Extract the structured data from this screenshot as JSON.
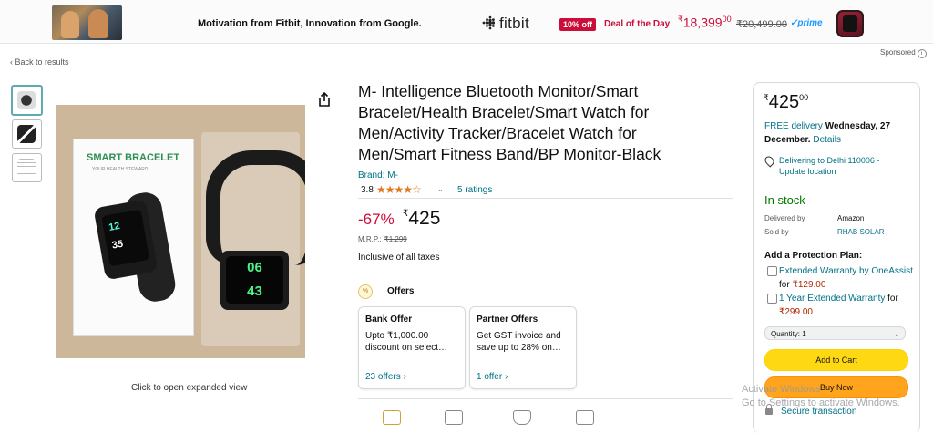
{
  "banner": {
    "tagline": "Motivation from Fitbit, Innovation from Google.",
    "brand": "fitbit",
    "discount_badge": "10% off",
    "deal_label": "Deal of the Day",
    "price_symbol": "₹",
    "price_whole": "18,399",
    "price_fraction": "00",
    "mrp": "₹20,499.00",
    "prime": "✓prime"
  },
  "sponsored": "Sponsored",
  "back_link": "‹ Back to results",
  "gallery": {
    "expand_hint": "Click to open expanded view",
    "box_title": "SMART BRACELET",
    "box_subtitle": "YOUR HEALTH STEWARD",
    "box_time_top": "12",
    "box_time_bottom": "35",
    "watch_time_top": "06",
    "watch_time_bottom": "43"
  },
  "product": {
    "title": "M- Intelligence Bluetooth Monitor/Smart Bracelet/Health Bracelet/Smart Watch for Men/Activity Tracker/Bracelet Watch for Men/Smart Fitness Band/BP Monitor-Black",
    "brand": "Brand: M-",
    "rating": "3.8",
    "stars": "★★★★☆",
    "ratings_count": "5 ratings",
    "discount": "-67%",
    "price_symbol": "₹",
    "price": "425",
    "mrp_label": "M.R.P.:",
    "mrp_value": "₹1,299",
    "taxes": "Inclusive of all taxes"
  },
  "offers": {
    "title": "Offers",
    "cards": [
      {
        "title": "Bank Offer",
        "body": "Upto ₹1,000.00 discount on select…",
        "link": "23 offers ›"
      },
      {
        "title": "Partner Offers",
        "body": "Get GST invoice and save up to 28% on…",
        "link": "1 offer ›"
      }
    ]
  },
  "buybox": {
    "price_symbol": "₹",
    "price_whole": "425",
    "price_fraction": "00",
    "free_delivery": "FREE delivery",
    "delivery_date": "Wednesday, 27 December.",
    "details_link": "Details",
    "location": "Delivering to Delhi 110006 - Update location",
    "stock": "In stock",
    "delivered_by_label": "Delivered by",
    "delivered_by_value": "Amazon",
    "sold_by_label": "Sold by",
    "sold_by_value": "RHAB SOLAR",
    "protection_title": "Add a Protection Plan:",
    "plan1_link": "Extended Warranty by OneAssist",
    "plan1_for": "for",
    "plan1_price": "₹129.00",
    "plan2_link": "1 Year Extended Warranty",
    "plan2_for": "for",
    "plan2_price": "₹299.00",
    "quantity": "Quantity: 1",
    "add_to_cart": "Add to Cart",
    "buy_now": "Buy Now",
    "secure": "Secure transaction"
  },
  "os_watermark": {
    "line1": "Activate Windows",
    "line2": "Go to Settings to activate Windows."
  },
  "colors": {
    "deal_red": "#cc0c39",
    "link_teal": "#007185",
    "stock_green": "#007600",
    "cart_yellow": "#ffd814",
    "buy_orange": "#ffa41c",
    "star_orange": "#de7921"
  }
}
